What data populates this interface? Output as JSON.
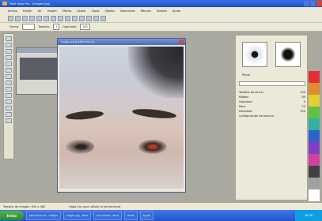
{
  "window": {
    "title": "Paint Shop Pro - [imagen.jpg]"
  },
  "menu": [
    "Archivo",
    "Edición",
    "Ver",
    "Imagen",
    "Efectos",
    "Ajustar",
    "Capas",
    "Objetos",
    "Selecciones",
    "Máscara",
    "Ventana",
    "Ayuda"
  ],
  "toolbar2": {
    "shape": "Forma:",
    "size_label": "Tamaño:",
    "size_value": "1",
    "opacity_label": "Opacidad:",
    "opacity_value": "100"
  },
  "image_window": {
    "title": "imagen.jpg @ 100% (Fondo)"
  },
  "right_panel": {
    "brush_label": "Pincel",
    "rows": [
      {
        "label": "Tamaño de pincel",
        "value": "100"
      },
      {
        "label": "Nitidez",
        "value": "80"
      },
      {
        "label": "Opacidad",
        "value": "0"
      },
      {
        "label": "Paso",
        "value": "25"
      },
      {
        "label": "Densidad",
        "value": "100"
      },
      {
        "label": "Configuración de textura",
        "value": ""
      }
    ]
  },
  "status": {
    "left": "Tamaño de imagen: 640 x 480",
    "right": "Haga clic para utilizar la herramienta"
  },
  "taskbar": {
    "start": "Inicio",
    "tasks": [
      "Paint Shop Pro - imagen",
      "imagen.jpg - Paint",
      "Documento - Word",
      "Mi PC",
      "Ayuda"
    ],
    "clock": "16:35"
  },
  "colors": {
    "accent": "#2255cc",
    "panel": "#ece9d8"
  }
}
